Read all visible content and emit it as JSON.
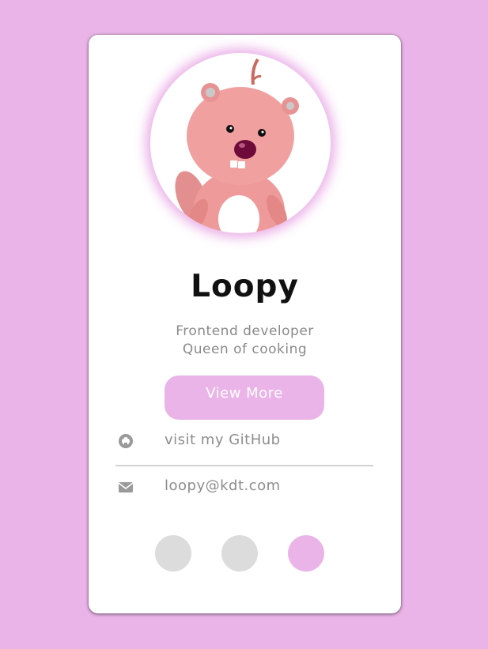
{
  "profile": {
    "name": "Loopy",
    "bio_line1": "Frontend developer",
    "bio_line2": "Queen of cooking",
    "avatar_icon": "loopy-beaver-avatar"
  },
  "actions": {
    "view_more_label": "View More"
  },
  "contacts": {
    "github_icon": "github-icon",
    "github_text": "visit my GitHub",
    "email_icon": "envelope-icon",
    "email_text": "loopy@kdt.com"
  },
  "pagination": {
    "dots": 3,
    "active_index": 3
  },
  "colors": {
    "background": "#eab4e8",
    "accent": "#eab4e8",
    "card": "#ffffff",
    "inactive_dot": "#dcdcdc",
    "muted_text": "#8d8d8d"
  }
}
